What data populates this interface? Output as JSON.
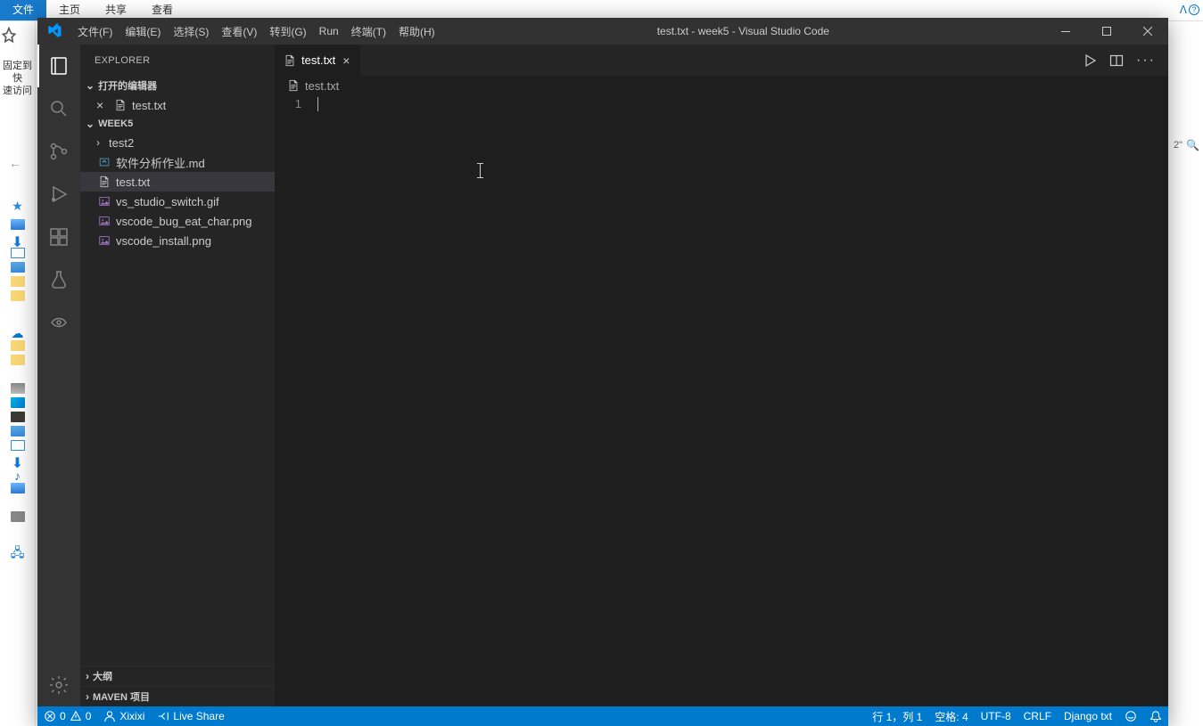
{
  "desktop": {
    "tab_file": "文件",
    "tab_home": "主页",
    "tab_share": "共享",
    "tab_view": "查看",
    "quick_access_line1": "固定到快",
    "quick_access_line2": "速访问",
    "search_suffix": "2\"",
    "search_icon_label": "搜索"
  },
  "titlebar": {
    "menu": [
      "文件(F)",
      "编辑(E)",
      "选择(S)",
      "查看(V)",
      "转到(G)",
      "Run",
      "终端(T)",
      "帮助(H)"
    ],
    "title": "test.txt - week5 - Visual Studio Code"
  },
  "sidebar": {
    "header": "EXPLORER",
    "open_editors_label": "打开的编辑器",
    "open_editors": [
      {
        "name": "test.txt"
      }
    ],
    "workspace": "WEEK5",
    "tree": [
      {
        "type": "folder",
        "name": "test2"
      },
      {
        "type": "md",
        "name": "软件分析作业.md"
      },
      {
        "type": "txt",
        "name": "test.txt",
        "selected": true
      },
      {
        "type": "img",
        "name": "vs_studio_switch.gif"
      },
      {
        "type": "img",
        "name": "vscode_bug_eat_char.png"
      },
      {
        "type": "img",
        "name": "vscode_install.png"
      }
    ],
    "outline_label": "大纲",
    "maven_label": "MAVEN 项目"
  },
  "tab": {
    "name": "test.txt"
  },
  "breadcrumb": {
    "file": "test.txt"
  },
  "editor": {
    "line_number": "1"
  },
  "status": {
    "errors": "0",
    "warnings": "0",
    "user": "Xixixi",
    "liveshare": "Live Share",
    "position": "行 1，列 1",
    "spaces": "空格: 4",
    "encoding": "UTF-8",
    "eol": "CRLF",
    "language": "Django txt"
  }
}
